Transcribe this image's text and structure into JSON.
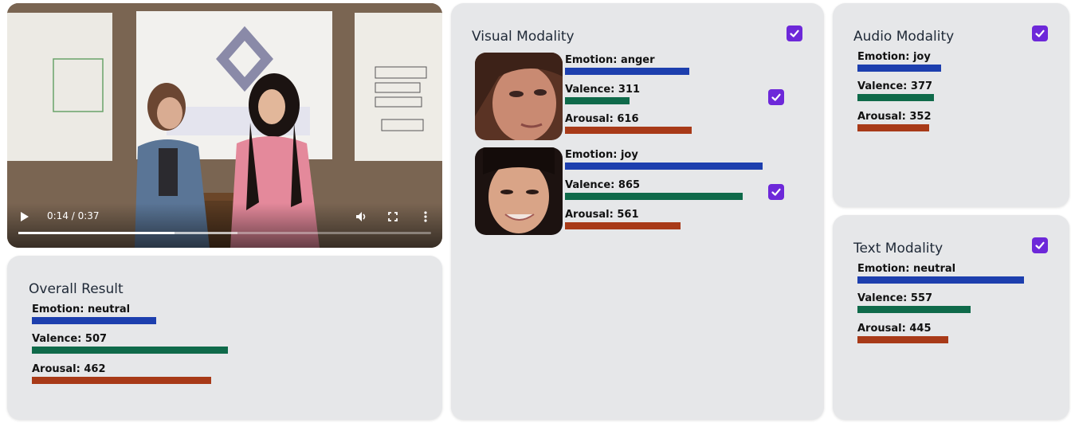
{
  "video": {
    "time_display": "0:14 / 0:37",
    "progress_fraction": 0.378,
    "buffer_fraction": 0.53
  },
  "overall": {
    "title": "Overall Result",
    "emotion_label": "Emotion: neutral",
    "valence_label": "Valence: 507",
    "arousal_label": "Arousal: 462",
    "emotion_score": 0.321,
    "valence_score": 0.507,
    "arousal_score": 0.462
  },
  "visual": {
    "title": "Visual Modality",
    "checked": true,
    "faces": [
      {
        "emotion_label": "Emotion: anger",
        "valence_label": "Valence: 311",
        "arousal_label": "Arousal: 616",
        "emotion_score": 0.63,
        "valence_score": 0.327,
        "arousal_score": 0.64,
        "checked": true
      },
      {
        "emotion_label": "Emotion: joy",
        "valence_label": "Valence: 865",
        "arousal_label": "Arousal: 561",
        "emotion_score": 1.0,
        "valence_score": 0.9,
        "arousal_score": 0.584,
        "checked": true
      }
    ]
  },
  "audio": {
    "title": "Audio Modality",
    "checked": true,
    "emotion_label": "Emotion: joy",
    "valence_label": "Valence: 377",
    "arousal_label": "Arousal: 352",
    "emotion_score": 0.5,
    "valence_score": 0.46,
    "arousal_score": 0.43
  },
  "text": {
    "title": "Text Modality",
    "checked": true,
    "emotion_label": "Emotion: neutral",
    "valence_label": "Valence: 557",
    "arousal_label": "Arousal: 445",
    "emotion_score": 1.0,
    "valence_score": 0.68,
    "arousal_score": 0.545
  },
  "colors": {
    "emotion_bar": "#1d3fae",
    "valence_bar": "#0f6a4a",
    "arousal_bar": "#a83a18",
    "checkbox": "#6d28d9",
    "card_bg": "#e6e7e9"
  },
  "icons": {
    "play": "play-icon",
    "volume": "volume-icon",
    "fullscreen": "fullscreen-icon",
    "more": "more-options-icon",
    "checkbox": "checkmark-icon"
  }
}
